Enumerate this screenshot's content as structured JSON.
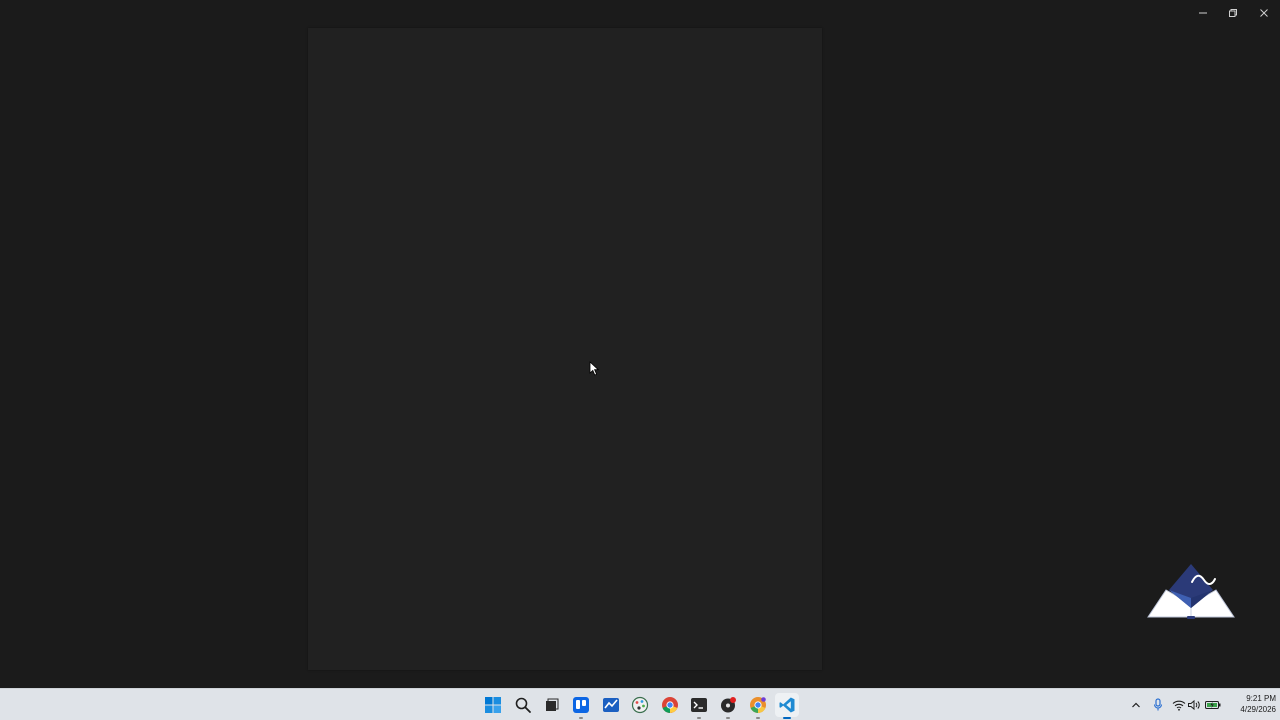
{
  "window": {
    "controls": {
      "minimize_icon": "minimize-icon",
      "restore_icon": "restore-icon",
      "close_icon": "close-icon"
    }
  },
  "colors": {
    "window_background": "#1b1b1b",
    "page_background": "#212121",
    "taskbar_background": "#dfe3e8",
    "accent": "#0067c0"
  },
  "taskbar": {
    "pinned": [
      {
        "icon": "windows-start-icon"
      },
      {
        "icon": "search-icon"
      },
      {
        "icon": "task-view-icon"
      },
      {
        "icon": "trello-icon"
      },
      {
        "icon": "app-chart-icon"
      },
      {
        "icon": "paint-icon"
      },
      {
        "icon": "chrome-icon"
      },
      {
        "icon": "terminal-icon"
      },
      {
        "icon": "obs-icon"
      },
      {
        "icon": "chrome-canary-icon"
      },
      {
        "icon": "vscode-icon"
      }
    ],
    "tray": {
      "icons": [
        "chevron-up-icon",
        "microphone-icon",
        "wifi-icon",
        "volume-icon",
        "battery-icon"
      ]
    },
    "clock": {
      "time": "9:21 PM",
      "date": "4/29/2026"
    }
  }
}
